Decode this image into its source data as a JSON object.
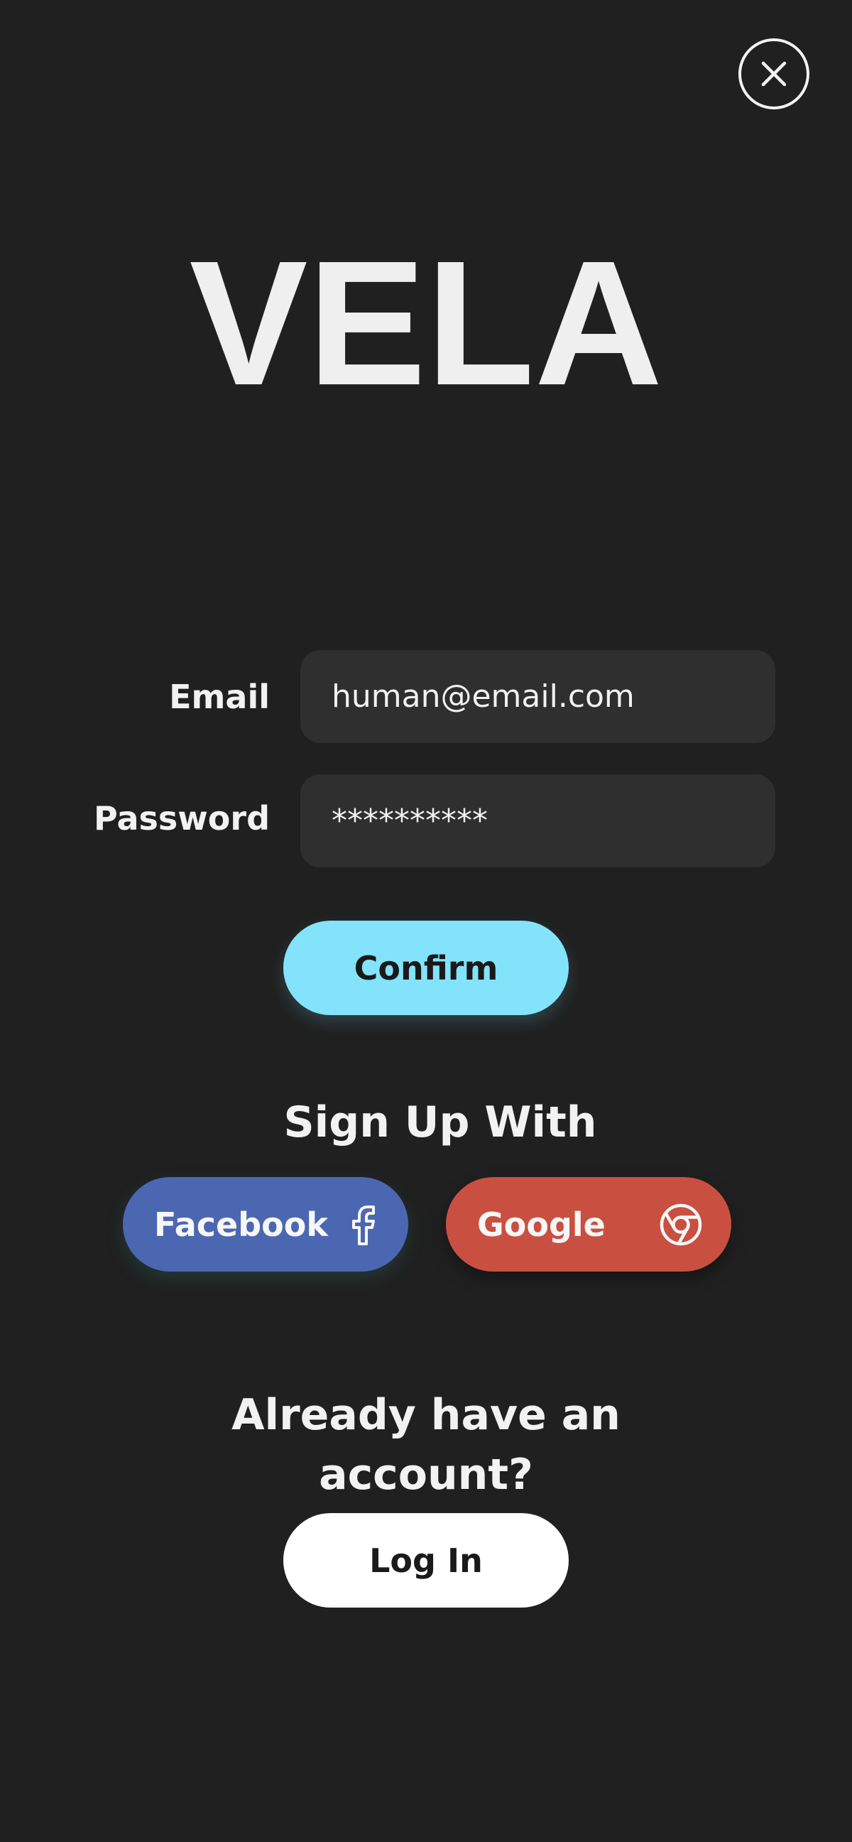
{
  "app": {
    "logo": "VELA"
  },
  "form": {
    "email_label": "Email",
    "email_value": "human@email.com",
    "password_label": "Password",
    "password_value": "**********",
    "confirm_label": "Confirm"
  },
  "signup": {
    "title": "Sign Up With",
    "facebook_label": "Facebook",
    "facebook_icon": "facebook-icon",
    "google_label": "Google",
    "google_icon": "chrome-icon"
  },
  "login": {
    "prompt_line1": "Already have an",
    "prompt_line2": "account?",
    "button_label": "Log In"
  },
  "colors": {
    "background": "#202020",
    "input_bg": "#2f2f2f",
    "confirm": "#83e3fb",
    "facebook": "#4c67b2",
    "google": "#c95040",
    "login": "#ffffff"
  }
}
